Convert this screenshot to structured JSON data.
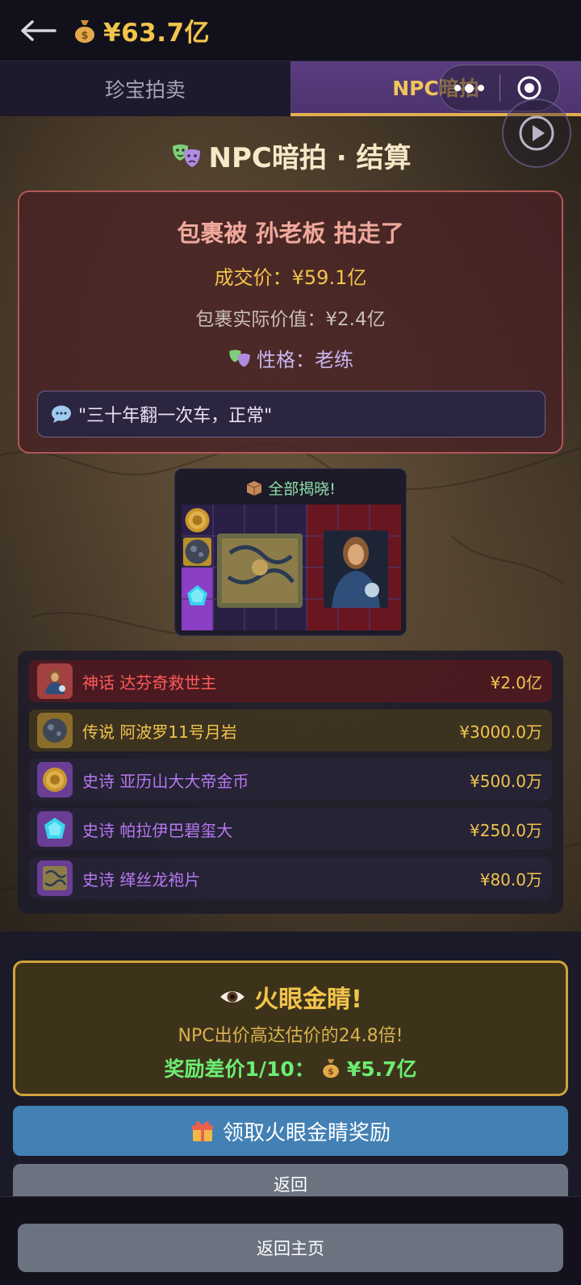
{
  "header": {
    "balance": "¥63.7亿",
    "moneybag_icon": "money-bag-icon"
  },
  "tabs": [
    {
      "label": "珍宝拍卖",
      "active": false
    },
    {
      "label": "NPC暗拍",
      "active": true
    }
  ],
  "settlement": {
    "title": "NPC暗拍 · 结算",
    "headline": "包裹被 孙老板 拍走了",
    "deal_price": "成交价：¥59.1亿",
    "real_value": "包裹实际价值：¥2.4亿",
    "personality": "性格：老练",
    "quote": "\"三十年翻一次车，正常\""
  },
  "reveal": {
    "title": "全部揭晓!"
  },
  "items": [
    {
      "rarity": "myth",
      "name": "神话 达芬奇救世主",
      "price": "¥2.0亿",
      "icon": "salvator-mundi-icon"
    },
    {
      "rarity": "legend",
      "name": "传说 阿波罗11号月岩",
      "price": "¥3000.0万",
      "icon": "moon-rock-icon"
    },
    {
      "rarity": "epic",
      "name": "史诗 亚历山大大帝金币",
      "price": "¥500.0万",
      "icon": "gold-coin-icon"
    },
    {
      "rarity": "epic",
      "name": "史诗 帕拉伊巴碧玺大",
      "price": "¥250.0万",
      "icon": "tourmaline-gem-icon"
    },
    {
      "rarity": "epic",
      "name": "史诗 缂丝龙袍片",
      "price": "¥80.0万",
      "icon": "dragon-robe-icon"
    }
  ],
  "reward": {
    "title": "火眼金睛!",
    "desc": "NPC出价高达估价的24.8倍!",
    "amount_label": "奖励差价1/10：",
    "amount_value": "¥5.7亿"
  },
  "buttons": {
    "claim": "领取火眼金睛奖励",
    "return": "返回",
    "home": "返回主页"
  },
  "colors": {
    "gold": "#f2c44c",
    "myth": "#ff5a5a",
    "epic": "#b678f0",
    "claim_button": "#4380b4",
    "reward_green": "#6bee72"
  }
}
